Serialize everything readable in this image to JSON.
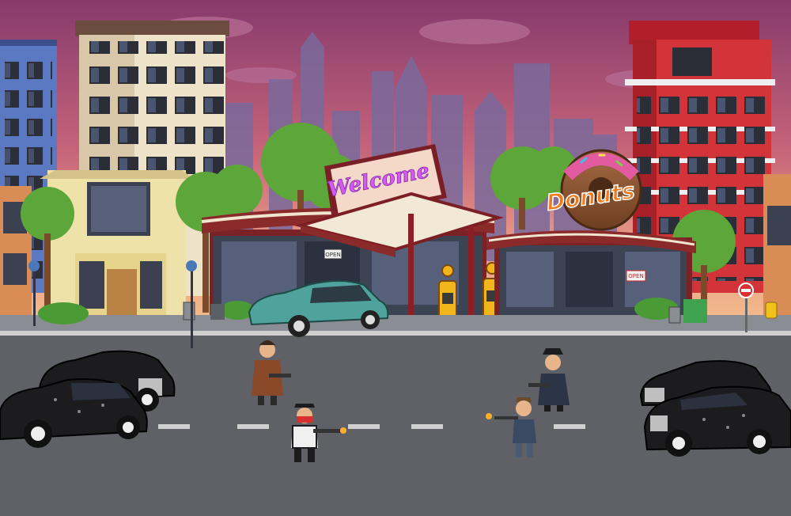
{
  "signs": {
    "welcome": "Welcome",
    "donuts": "Donuts",
    "open_station": "OPEN",
    "open_donut": "OPEN"
  },
  "colors": {
    "sky_top": "#8a3d6e",
    "sky_bottom": "#f2b58a",
    "road": "#5f6166",
    "neon_pink": "#d15cf0",
    "donut_orange": "#f07a1a",
    "fuel_pump_yellow": "#f2b51c",
    "vintage_car_teal": "#4fa39c",
    "gangster_car_black": "#1c1c1e"
  },
  "icons": [
    "no-entry-sign-icon",
    "fuel-pump-icon",
    "street-lamp-icon"
  ]
}
